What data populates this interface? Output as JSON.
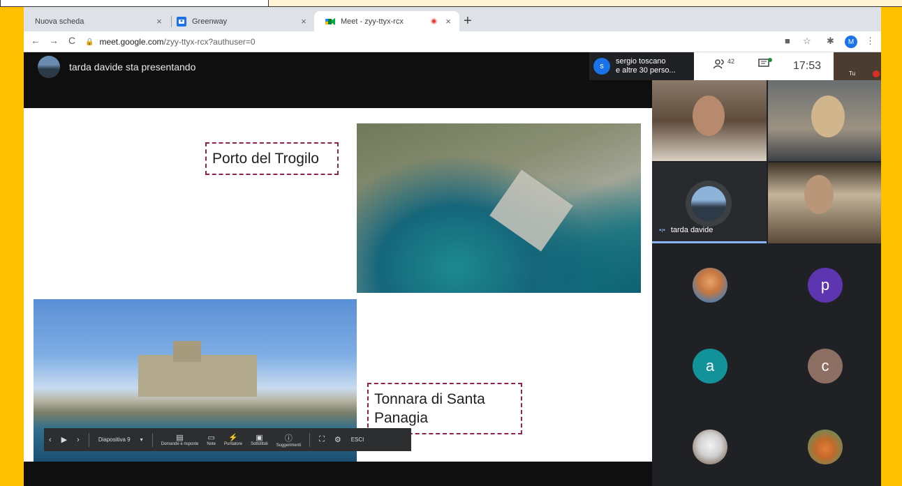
{
  "browser": {
    "tabs": [
      {
        "label": "Nuova scheda",
        "close": "×"
      },
      {
        "label": "Greenway",
        "close": "×"
      },
      {
        "label": "Meet - zyy-ttyx-rcx",
        "close": "×"
      }
    ],
    "new_tab": "+",
    "url_host": "meet.google.com",
    "url_path": "/zyy-ttyx-rcx?authuser=0",
    "profile_initial": "M",
    "greenway_favicon_letter": "",
    "colors": {
      "profile": "#1a73e8",
      "recording": "#e53935"
    }
  },
  "meet": {
    "presenter_text": "tarda davide sta presentando",
    "chip": {
      "avatar_letter": "s",
      "line1": "sergio toscano",
      "line2": "e altre 30 perso..."
    },
    "participants_count": "42",
    "clock": "17:53",
    "self_label": "Tu",
    "slide": {
      "label_top": "Porto del Trogilo",
      "label_bottom": "Tonnara di Santa Panagia"
    },
    "controls": {
      "slide_label": "Diapositiva 9",
      "tools": [
        {
          "icon": "qa-icon",
          "label": "Domande e risposte"
        },
        {
          "icon": "notes-icon",
          "label": "Note"
        },
        {
          "icon": "pointer-icon",
          "label": "Puntatore"
        },
        {
          "icon": "captions-icon",
          "label": "Sottotitoli"
        },
        {
          "icon": "info-icon",
          "label": "Suggerimenti"
        }
      ],
      "exit_label": "ESCI"
    },
    "tiles": {
      "presenter_name": "tarda davide",
      "avatars": [
        {
          "letter": "",
          "color": "#e8a36a"
        },
        {
          "letter": "p",
          "color": "#5e35b1"
        },
        {
          "letter": "a",
          "color": "#12939a"
        },
        {
          "letter": "c",
          "color": "#8d6e63"
        },
        {
          "letter": "",
          "color": "#cfcfcf"
        },
        {
          "letter": "",
          "color": "#e27d3a"
        }
      ]
    }
  }
}
